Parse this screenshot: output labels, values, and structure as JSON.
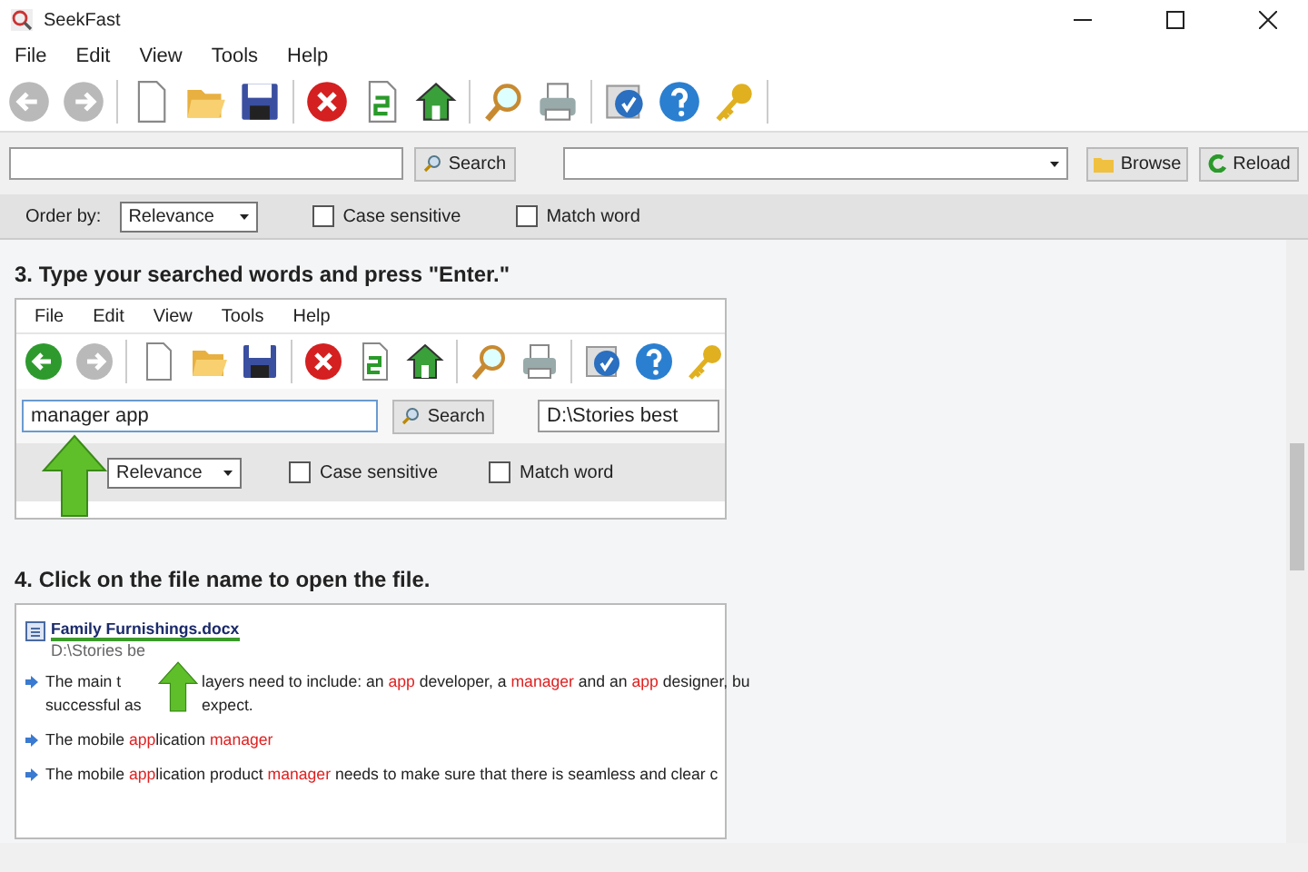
{
  "window": {
    "title": "SeekFast"
  },
  "menu": [
    "File",
    "Edit",
    "View",
    "Tools",
    "Help"
  ],
  "toolbar": [
    {
      "kind": "back",
      "disabled": true
    },
    {
      "kind": "forward",
      "disabled": true
    },
    {
      "kind": "new",
      "disabled": false
    },
    {
      "kind": "open",
      "disabled": false
    },
    {
      "kind": "save",
      "disabled": false
    },
    {
      "kind": "stop",
      "disabled": false
    },
    {
      "kind": "refresh",
      "disabled": false
    },
    {
      "kind": "home",
      "disabled": false
    },
    {
      "kind": "find",
      "disabled": false
    },
    {
      "kind": "print",
      "disabled": false
    },
    {
      "kind": "about",
      "disabled": false
    },
    {
      "kind": "help",
      "disabled": false
    },
    {
      "kind": "key",
      "disabled": false
    }
  ],
  "search": {
    "button": "Search"
  },
  "folder": {
    "browse": "Browse",
    "reload": "Reload"
  },
  "options": {
    "order_label": "Order by:",
    "order_value": "Relevance",
    "case_sensitive": {
      "label": "Case sensitive",
      "checked": false
    },
    "match_word": {
      "label": "Match word",
      "checked": false
    }
  },
  "steps": [
    {
      "kind": "screenshot",
      "heading": "3. Type your searched words and press \"Enter.\"",
      "menu": [
        "File",
        "Edit",
        "View",
        "Tools",
        "Help"
      ],
      "toolbar": [
        {
          "kind": "back",
          "disabled": false
        },
        {
          "kind": "forward",
          "disabled": true
        },
        {
          "kind": "new",
          "disabled": false
        },
        {
          "kind": "open",
          "disabled": false
        },
        {
          "kind": "save",
          "disabled": false
        },
        {
          "kind": "stop",
          "disabled": false
        },
        {
          "kind": "refresh",
          "disabled": false
        },
        {
          "kind": "home",
          "disabled": false
        },
        {
          "kind": "find",
          "disabled": false
        },
        {
          "kind": "print",
          "disabled": false
        },
        {
          "kind": "about",
          "disabled": false
        },
        {
          "kind": "help",
          "disabled": false
        },
        {
          "kind": "key",
          "disabled": false
        }
      ],
      "search": {
        "value": "manager app",
        "button": "Search"
      },
      "folder": {
        "value": "D:\\Stories best"
      },
      "options": {
        "order_value": "Relevance",
        "case_sensitive": {
          "label": "Case sensitive",
          "checked": false
        },
        "match_word": {
          "label": "Match word",
          "checked": false
        }
      }
    },
    {
      "kind": "results",
      "heading": "4. Click on the file name to open the file.",
      "file": {
        "name": "Family Furnishings.docx",
        "path": "D:\\Stories be"
      },
      "snippets": [
        {
          "lines": [
            [
              {
                "text": "The main t",
                "hit": false
              },
              {
                "text": "layers need to include: an ",
                "hit": false
              },
              {
                "text": "app",
                "hit": true
              },
              {
                "text": " developer, a ",
                "hit": false
              },
              {
                "text": "manager",
                "hit": true
              },
              {
                "text": " and an ",
                "hit": false
              },
              {
                "text": "app",
                "hit": true
              },
              {
                "text": " designer, bu",
                "hit": false
              }
            ],
            [
              {
                "text": "successful as",
                "hit": false
              },
              {
                "text": "expect.",
                "hit": false
              }
            ]
          ]
        },
        {
          "lines": [
            [
              {
                "text": "The mobile ",
                "hit": false
              },
              {
                "text": "app",
                "hit": true
              },
              {
                "text": "lication ",
                "hit": false
              },
              {
                "text": "manager",
                "hit": true
              }
            ]
          ]
        },
        {
          "lines": [
            [
              {
                "text": "The mobile ",
                "hit": false
              },
              {
                "text": "app",
                "hit": true
              },
              {
                "text": "lication product ",
                "hit": false
              },
              {
                "text": "manager",
                "hit": true
              },
              {
                "text": " needs to make sure that there is seamless and clear c",
                "hit": false
              }
            ]
          ]
        }
      ]
    }
  ]
}
